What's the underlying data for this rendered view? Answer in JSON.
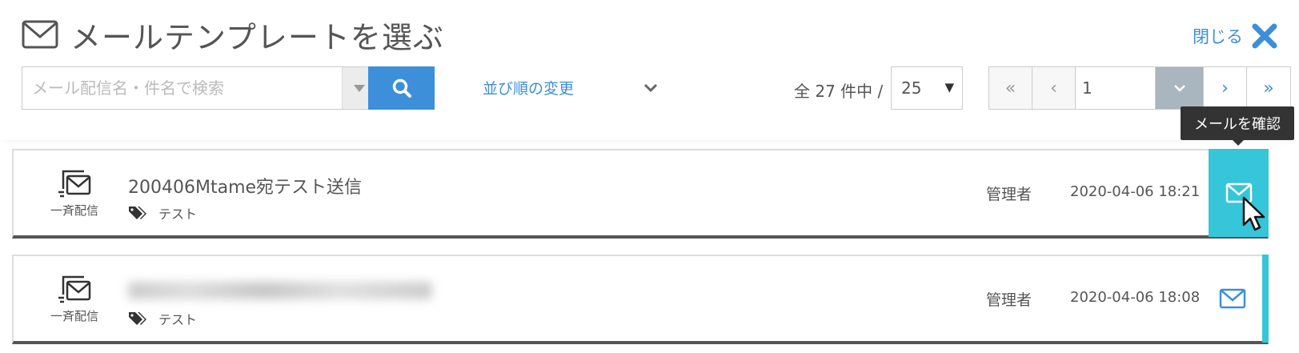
{
  "dialog": {
    "title": "メールテンプレートを選ぶ",
    "close_label": "閉じる"
  },
  "search": {
    "placeholder": "メール配信名・件名で検索"
  },
  "sort": {
    "label": "並び順の変更"
  },
  "results": {
    "count_text": "全 27 件中 /",
    "per_page": "25"
  },
  "pager": {
    "first": "«",
    "prev": "‹",
    "page": "1",
    "next": "›",
    "last": "»"
  },
  "tooltip": {
    "text": "メールを確認"
  },
  "items": [
    {
      "type_label": "一斉配信",
      "name": "200406Mtame宛テスト送信",
      "tag": "テスト",
      "author": "管理者",
      "date": "2020-04-06 18:21"
    },
    {
      "type_label": "一斉配信",
      "name": "",
      "tag": "テスト",
      "author": "管理者",
      "date": "2020-04-06 18:08"
    }
  ],
  "colors": {
    "accent": "#3d8fd9",
    "teal": "#35c6d9",
    "pager_dropdown": "#a9b5bf"
  }
}
